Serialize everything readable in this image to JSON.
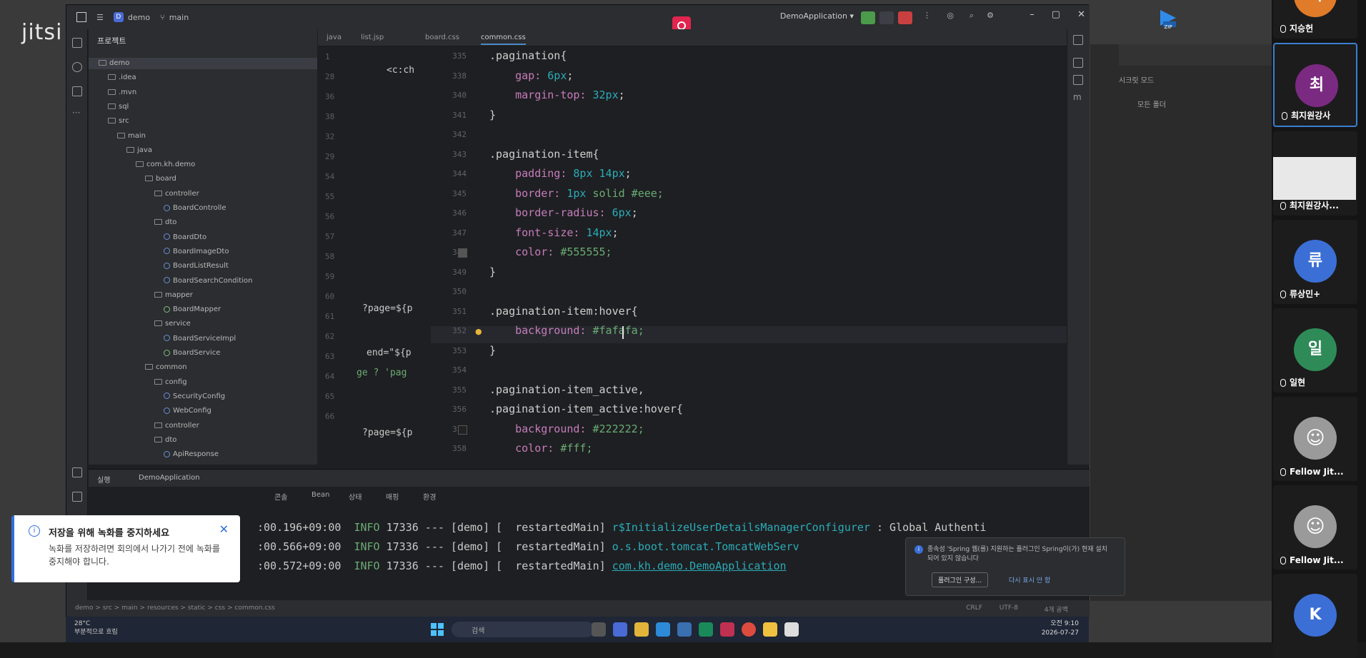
{
  "meeting": {
    "logo": "jitsi"
  },
  "ide": {
    "project_name": "demo",
    "branch": "main",
    "run_config": "DemoApplication",
    "project_pane_title": "프로젝트",
    "tabs": [
      "java",
      "list.jsp",
      "board.css",
      "common.css"
    ],
    "active_tab": "common.css",
    "tree": [
      {
        "label": "demo",
        "depth": 0,
        "kind": "folder"
      },
      {
        "label": ".idea",
        "depth": 1,
        "kind": "folder"
      },
      {
        "label": ".mvn",
        "depth": 1,
        "kind": "folder"
      },
      {
        "label": "sql",
        "depth": 1,
        "kind": "folder"
      },
      {
        "label": "src",
        "depth": 1,
        "kind": "folder"
      },
      {
        "label": "main",
        "depth": 2,
        "kind": "folder"
      },
      {
        "label": "java",
        "depth": 3,
        "kind": "folder"
      },
      {
        "label": "com.kh.demo",
        "depth": 4,
        "kind": "folder"
      },
      {
        "label": "board",
        "depth": 5,
        "kind": "folder"
      },
      {
        "label": "controller",
        "depth": 6,
        "kind": "folder"
      },
      {
        "label": "BoardControlle",
        "depth": 7,
        "kind": "class"
      },
      {
        "label": "dto",
        "depth": 6,
        "kind": "folder"
      },
      {
        "label": "BoardDto",
        "depth": 7,
        "kind": "class"
      },
      {
        "label": "BoardImageDto",
        "depth": 7,
        "kind": "class"
      },
      {
        "label": "BoardListResult",
        "depth": 7,
        "kind": "class"
      },
      {
        "label": "BoardSearchCondition",
        "depth": 7,
        "kind": "class"
      },
      {
        "label": "mapper",
        "depth": 6,
        "kind": "folder"
      },
      {
        "label": "BoardMapper",
        "depth": 7,
        "kind": "interface"
      },
      {
        "label": "service",
        "depth": 6,
        "kind": "folder"
      },
      {
        "label": "BoardServiceImpl",
        "depth": 7,
        "kind": "class"
      },
      {
        "label": "BoardService",
        "depth": 7,
        "kind": "interface"
      },
      {
        "label": "common",
        "depth": 5,
        "kind": "folder"
      },
      {
        "label": "config",
        "depth": 6,
        "kind": "folder"
      },
      {
        "label": "SecurityConfig",
        "depth": 7,
        "kind": "class"
      },
      {
        "label": "WebConfig",
        "depth": 7,
        "kind": "class"
      },
      {
        "label": "controller",
        "depth": 6,
        "kind": "folder"
      },
      {
        "label": "dto",
        "depth": 6,
        "kind": "folder"
      },
      {
        "label": "ApiResponse",
        "depth": 7,
        "kind": "class"
      }
    ],
    "left_editor": {
      "line_numbers": [
        "1",
        "28",
        "36",
        "38",
        "32",
        "29",
        "54",
        "55",
        "56",
        "57",
        "58",
        "59",
        "60",
        "61",
        "62",
        "63",
        "64",
        "65",
        "66"
      ],
      "fragments": [
        "<c:ch",
        "?page=${p",
        "end=\"${p",
        "ge ? 'pag",
        "?page=${p"
      ]
    },
    "code": [
      {
        "ln": "335",
        "tokens": [
          {
            "t": ".pagination{",
            "c": "sel"
          }
        ]
      },
      {
        "ln": "338",
        "tokens": [
          {
            "t": "    gap: ",
            "c": "prop"
          },
          {
            "t": "6px",
            "c": "num"
          },
          {
            "t": ";",
            "c": "sel"
          }
        ]
      },
      {
        "ln": "340",
        "tokens": [
          {
            "t": "    margin-top: ",
            "c": "prop"
          },
          {
            "t": "32px",
            "c": "num"
          },
          {
            "t": ";",
            "c": "sel"
          }
        ]
      },
      {
        "ln": "341",
        "tokens": [
          {
            "t": "}",
            "c": "sel"
          }
        ]
      },
      {
        "ln": "342",
        "tokens": []
      },
      {
        "ln": "343",
        "tokens": [
          {
            "t": ".pagination-item{",
            "c": "sel"
          }
        ]
      },
      {
        "ln": "344",
        "tokens": [
          {
            "t": "    padding: ",
            "c": "prop"
          },
          {
            "t": "8px 14px",
            "c": "num"
          },
          {
            "t": ";",
            "c": "sel"
          }
        ]
      },
      {
        "ln": "345",
        "tokens": [
          {
            "t": "    border: ",
            "c": "prop"
          },
          {
            "t": "1px",
            "c": "num"
          },
          {
            "t": " solid #eee;",
            "c": "val"
          }
        ]
      },
      {
        "ln": "346",
        "tokens": [
          {
            "t": "    border-radius: ",
            "c": "prop"
          },
          {
            "t": "6px",
            "c": "num"
          },
          {
            "t": ";",
            "c": "sel"
          }
        ]
      },
      {
        "ln": "347",
        "tokens": [
          {
            "t": "    font-size: ",
            "c": "prop"
          },
          {
            "t": "14px",
            "c": "num"
          },
          {
            "t": ";",
            "c": "sel"
          }
        ]
      },
      {
        "ln": "348",
        "tokens": [
          {
            "t": "    color: ",
            "c": "prop"
          },
          {
            "t": "#555555;",
            "c": "val"
          }
        ]
      },
      {
        "ln": "349",
        "tokens": [
          {
            "t": "}",
            "c": "sel"
          }
        ]
      },
      {
        "ln": "350",
        "tokens": []
      },
      {
        "ln": "351",
        "tokens": [
          {
            "t": ".pagination-item:hover{",
            "c": "sel"
          }
        ]
      },
      {
        "ln": "352",
        "tokens": [
          {
            "t": "    background: ",
            "c": "prop"
          },
          {
            "t": "#fafafa;",
            "c": "val"
          }
        ]
      },
      {
        "ln": "353",
        "tokens": [
          {
            "t": "}",
            "c": "sel"
          }
        ]
      },
      {
        "ln": "354",
        "tokens": []
      },
      {
        "ln": "355",
        "tokens": [
          {
            "t": ".pagination-item_active,",
            "c": "sel"
          }
        ]
      },
      {
        "ln": "356",
        "tokens": [
          {
            "t": ".pagination-item_active:hover{",
            "c": "sel"
          }
        ]
      },
      {
        "ln": "357",
        "tokens": [
          {
            "t": "    background: ",
            "c": "prop"
          },
          {
            "t": "#222222;",
            "c": "val"
          }
        ]
      },
      {
        "ln": "358",
        "tokens": [
          {
            "t": "    color: ",
            "c": "prop"
          },
          {
            "t": "#fff;",
            "c": "val"
          }
        ]
      }
    ],
    "swatch_colors": {
      "348": "#555555",
      "357": "#222222"
    },
    "run_panel": {
      "title": "실행",
      "config_tab": "DemoApplication",
      "sub_tabs": [
        "콘솔",
        "Bean",
        "상태",
        "매핑",
        "환경"
      ],
      "logs": [
        {
          "time": ":00.196+09:00",
          "level": "INFO",
          "pid": "17336",
          "rest": " --- [demo] [  restartedMain] ",
          "logger": "r$InitializeUserDetailsManagerConfigurer",
          "msg": " : Global Authenti"
        },
        {
          "time": ":00.566+09:00",
          "level": "INFO",
          "pid": "17336",
          "rest": " --- [demo] [  restartedMain] ",
          "logger": "o.s.boot.tomcat.TomcatWebServ",
          "msg": ""
        },
        {
          "time": ":00.572+09:00",
          "level": "INFO",
          "pid": "17336",
          "rest": " --- [demo] [  restartedMain] ",
          "logger": "com.kh.demo.DemoApplication",
          "msg": ""
        }
      ]
    },
    "notification": {
      "text": "종속성 'Spring 웹(를) 지원하는 플러그인 Spring이(가) 현재 설치되어 있지 않습니다",
      "primary": "플러그인 구성...",
      "secondary": "다시 표시 안 함"
    },
    "statusbar": {
      "path": "demo > src > main > resources > static > css > common.css",
      "encoding": "UTF-8",
      "line_sep": "CRLF",
      "indent": "4개 공백"
    }
  },
  "taskbar": {
    "temp": "28°C",
    "weather": "부분적으로 흐림",
    "search_placeholder": "검색",
    "time": "오전 9:10",
    "date": "2026-07-27"
  },
  "toast": {
    "title": "저장을 위해 녹화를 중지하세요",
    "body": "녹화를 저장하려면 회의에서 나가기 전에 녹화를 중지해야 합니다."
  },
  "right_app": {
    "mode_label": "시크릿 모드",
    "folder_label": "모든 폴더",
    "zip_label": "ZIP"
  },
  "participants": [
    {
      "name": "지승헌",
      "initial": "지",
      "color": "#e07b2a",
      "active": false
    },
    {
      "name": "최지원강사",
      "initial": "최",
      "color": "#7b2a82",
      "active": true
    },
    {
      "name": "최지원강사...",
      "initial": "",
      "color": "",
      "active": false,
      "screen": true
    },
    {
      "name": "류상민+",
      "initial": "류",
      "color": "#3b6fd6",
      "active": false
    },
    {
      "name": "일현",
      "initial": "일",
      "color": "#2e8b57",
      "active": false
    },
    {
      "name": "Fellow Jit...",
      "initial": "",
      "color": "#9a9a9a",
      "active": false
    },
    {
      "name": "Fellow Jit...",
      "initial": "",
      "color": "#9a9a9a",
      "active": false
    },
    {
      "name": "",
      "initial": "K",
      "color": "#3b6fd6",
      "active": false
    }
  ]
}
